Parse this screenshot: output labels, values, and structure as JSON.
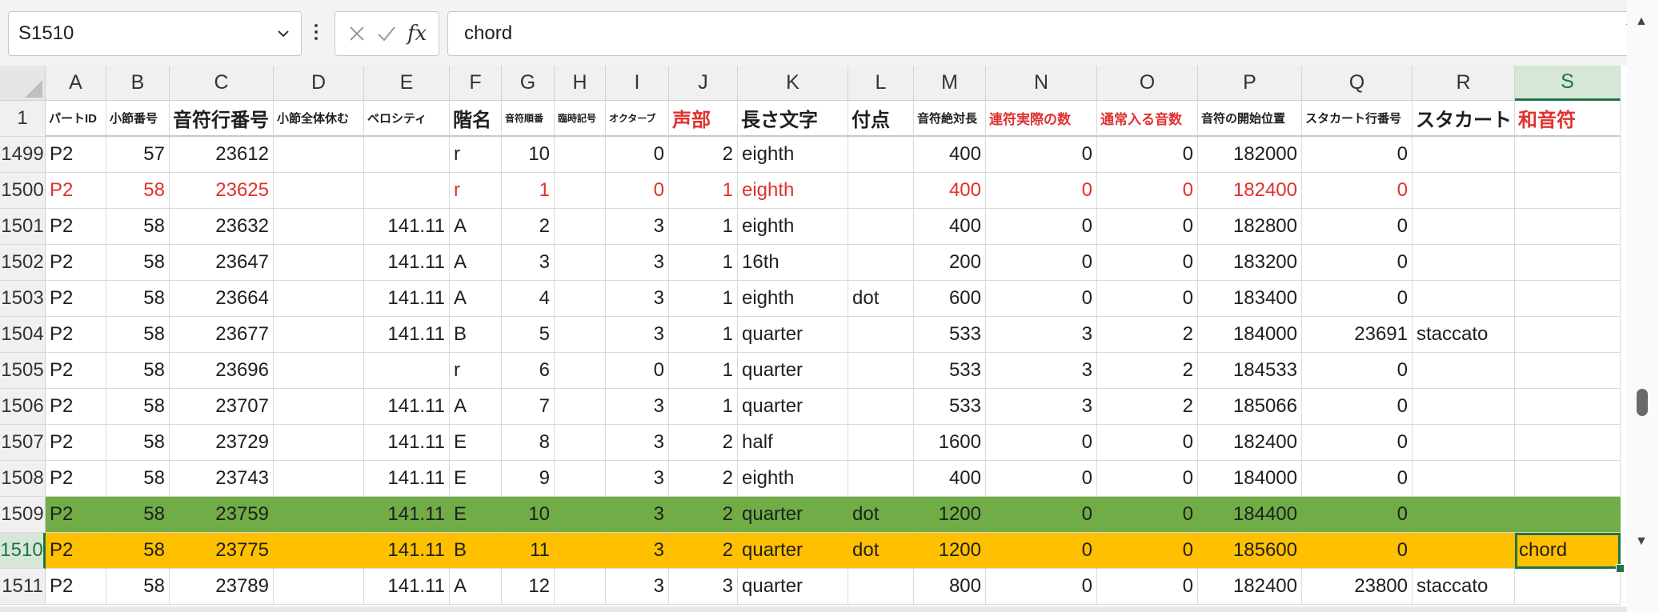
{
  "name_box": "S1510",
  "formula_value": "chord",
  "formula_icons": [
    "cancel-icon",
    "enter-icon",
    "fx-icon"
  ],
  "accent_colors": {
    "red": "#e0312e",
    "green_fill": "#70ad47",
    "orange_fill": "#ffc000",
    "selection": "#217346"
  },
  "columns": [
    "A",
    "B",
    "C",
    "D",
    "E",
    "F",
    "G",
    "H",
    "I",
    "J",
    "K",
    "L",
    "M",
    "N",
    "O",
    "P",
    "Q",
    "R",
    "S"
  ],
  "selected_column": "S",
  "header_row_number": "1",
  "headers": [
    {
      "text": "パートID",
      "size": "s"
    },
    {
      "text": "小節番号",
      "size": "s"
    },
    {
      "text": "音符行番号",
      "size": "l"
    },
    {
      "text": "小節全体休む",
      "size": "s"
    },
    {
      "text": "ベロシティ",
      "size": "s"
    },
    {
      "text": "階名",
      "size": "l"
    },
    {
      "text": "音符順番",
      "size": "xs"
    },
    {
      "text": "臨時記号",
      "size": "xs"
    },
    {
      "text": "オクターブ",
      "size": "xs"
    },
    {
      "text": "声部",
      "size": "l",
      "red": true
    },
    {
      "text": "長さ文字",
      "size": "l"
    },
    {
      "text": "付点",
      "size": "l"
    },
    {
      "text": "音符絶対長",
      "size": "s"
    },
    {
      "text": "連符実際の数",
      "size": "m",
      "red": true
    },
    {
      "text": "通常入る音数",
      "size": "m",
      "red": true
    },
    {
      "text": "音符の開始位置",
      "size": "s"
    },
    {
      "text": "スタカート行番号",
      "size": "s"
    },
    {
      "text": "スタカート",
      "size": "l"
    },
    {
      "text": "和音符",
      "size": "l",
      "red": true
    }
  ],
  "rows": [
    {
      "num": "1499",
      "style": "",
      "cells": [
        "P2",
        "57",
        "23612",
        "",
        "",
        "r",
        "10",
        "",
        "0",
        "2",
        "eighth",
        "",
        "400",
        "0",
        "0",
        "182000",
        "0",
        "",
        ""
      ]
    },
    {
      "num": "1500",
      "style": "red",
      "cells": [
        "P2",
        "58",
        "23625",
        "",
        "",
        "r",
        "1",
        "",
        "0",
        "1",
        "eighth",
        "",
        "400",
        "0",
        "0",
        "182400",
        "0",
        "",
        ""
      ]
    },
    {
      "num": "1501",
      "style": "",
      "cells": [
        "P2",
        "58",
        "23632",
        "",
        "141.11",
        "A",
        "2",
        "",
        "3",
        "1",
        "eighth",
        "",
        "400",
        "0",
        "0",
        "182800",
        "0",
        "",
        ""
      ]
    },
    {
      "num": "1502",
      "style": "",
      "cells": [
        "P2",
        "58",
        "23647",
        "",
        "141.11",
        "A",
        "3",
        "",
        "3",
        "1",
        "16th",
        "",
        "200",
        "0",
        "0",
        "183200",
        "0",
        "",
        ""
      ]
    },
    {
      "num": "1503",
      "style": "",
      "cells": [
        "P2",
        "58",
        "23664",
        "",
        "141.11",
        "A",
        "4",
        "",
        "3",
        "1",
        "eighth",
        "dot",
        "600",
        "0",
        "0",
        "183400",
        "0",
        "",
        ""
      ]
    },
    {
      "num": "1504",
      "style": "",
      "cells": [
        "P2",
        "58",
        "23677",
        "",
        "141.11",
        "B",
        "5",
        "",
        "3",
        "1",
        "quarter",
        "",
        "533",
        "3",
        "2",
        "184000",
        "23691",
        "staccato",
        ""
      ]
    },
    {
      "num": "1505",
      "style": "",
      "cells": [
        "P2",
        "58",
        "23696",
        "",
        "",
        "r",
        "6",
        "",
        "0",
        "1",
        "quarter",
        "",
        "533",
        "3",
        "2",
        "184533",
        "0",
        "",
        ""
      ]
    },
    {
      "num": "1506",
      "style": "",
      "cells": [
        "P2",
        "58",
        "23707",
        "",
        "141.11",
        "A",
        "7",
        "",
        "3",
        "1",
        "quarter",
        "",
        "533",
        "3",
        "2",
        "185066",
        "0",
        "",
        ""
      ]
    },
    {
      "num": "1507",
      "style": "",
      "cells": [
        "P2",
        "58",
        "23729",
        "",
        "141.11",
        "E",
        "8",
        "",
        "3",
        "2",
        "half",
        "",
        "1600",
        "0",
        "0",
        "182400",
        "0",
        "",
        ""
      ]
    },
    {
      "num": "1508",
      "style": "",
      "cells": [
        "P2",
        "58",
        "23743",
        "",
        "141.11",
        "E",
        "9",
        "",
        "3",
        "2",
        "eighth",
        "",
        "400",
        "0",
        "0",
        "184000",
        "0",
        "",
        ""
      ]
    },
    {
      "num": "1509",
      "style": "green",
      "cells": [
        "P2",
        "58",
        "23759",
        "",
        "141.11",
        "E",
        "10",
        "",
        "3",
        "2",
        "quarter",
        "dot",
        "1200",
        "0",
        "0",
        "184400",
        "0",
        "",
        ""
      ]
    },
    {
      "num": "1510",
      "style": "orange",
      "selected": true,
      "cells": [
        "P2",
        "58",
        "23775",
        "",
        "141.11",
        "B",
        "11",
        "",
        "3",
        "2",
        "quarter",
        "dot",
        "1200",
        "0",
        "0",
        "185600",
        "0",
        "",
        "chord"
      ]
    },
    {
      "num": "1511",
      "style": "",
      "cells": [
        "P2",
        "58",
        "23789",
        "",
        "141.11",
        "A",
        "12",
        "",
        "3",
        "3",
        "quarter",
        "",
        "800",
        "0",
        "0",
        "182400",
        "23800",
        "staccato",
        ""
      ]
    }
  ]
}
